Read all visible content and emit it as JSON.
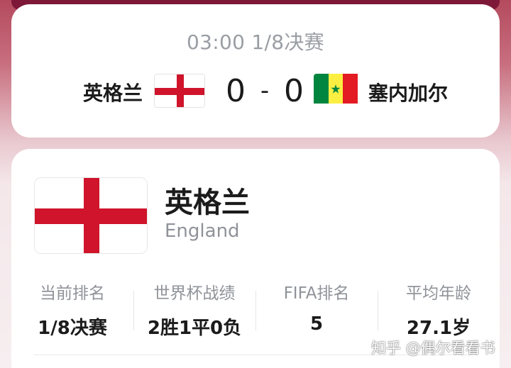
{
  "match": {
    "time": "03:00 1/8决赛",
    "home": {
      "name": "英格兰",
      "flag_icon": "england-flag-icon"
    },
    "away": {
      "name": "塞内加尔",
      "flag_icon": "senegal-flag-icon"
    },
    "score_home": "0",
    "score_sep": "-",
    "score_away": "0"
  },
  "team": {
    "name_cn": "英格兰",
    "name_en": "England",
    "flag_icon": "england-flag-icon",
    "stats": [
      {
        "label": "当前排名",
        "value": "1/8决赛"
      },
      {
        "label": "世界杯战绩",
        "value": "2胜1平0负"
      },
      {
        "label": "FIFA排名",
        "value": "5"
      },
      {
        "label": "平均年龄",
        "value": "27.1岁"
      }
    ]
  },
  "watermark": "知乎 @偶尔看看书",
  "colors": {
    "england_red": "#cf142b",
    "senegal_green": "#00853f",
    "senegal_yellow": "#fdef42",
    "senegal_red": "#e31b23",
    "header_maroon": "#7d1839"
  }
}
